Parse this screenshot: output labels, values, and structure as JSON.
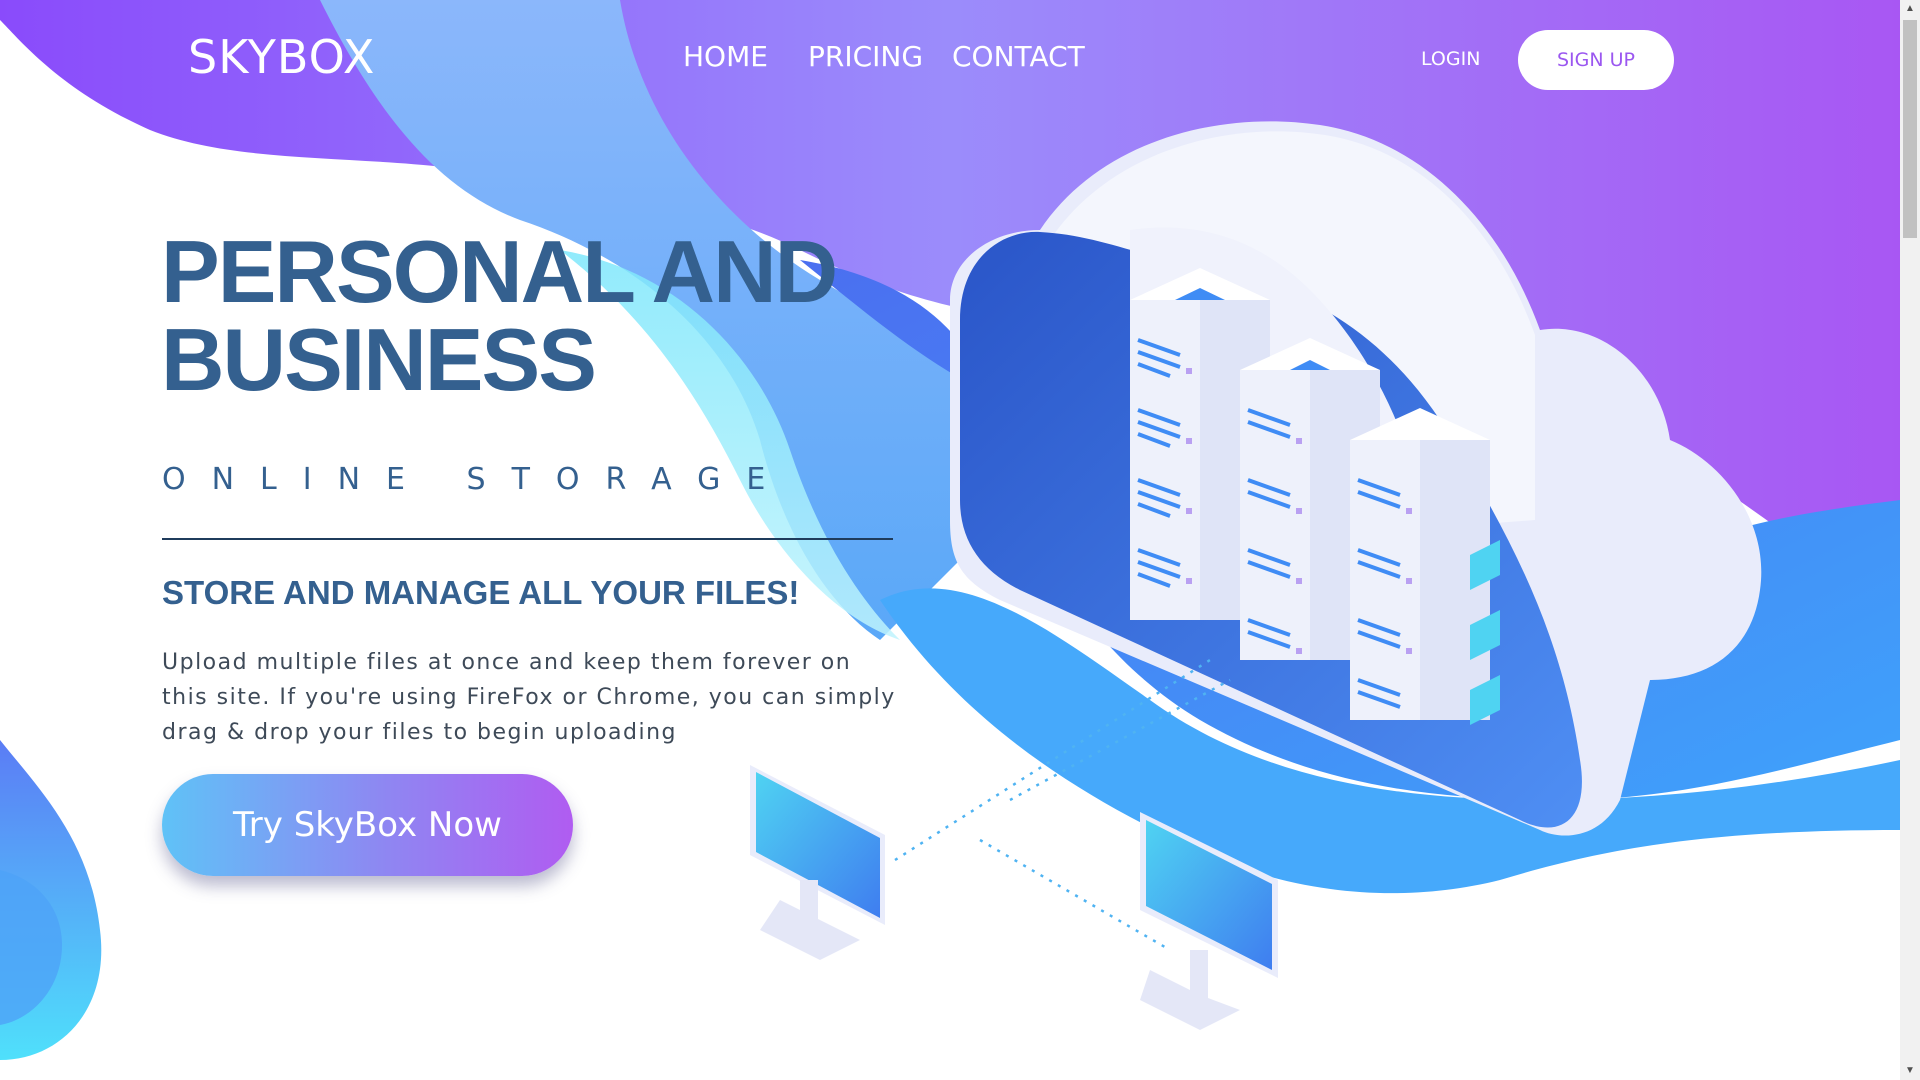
{
  "brand": {
    "logo": "SKYBOX"
  },
  "nav": {
    "links": [
      "HOME",
      "PRICING",
      "CONTACT"
    ],
    "login": "LOGIN",
    "signup": "SIGN UP"
  },
  "hero": {
    "title_line1": "PERSONAL AND",
    "title_line2": "BUSINESS",
    "subtitle": "ONLINE STORAGE",
    "tagline": "STORE AND MANAGE ALL YOUR FILES!",
    "description": "Upload multiple files at once and keep them forever on this site. If you're using FireFox or Chrome, you can simply drag & drop your files to begin uploading",
    "cta": "Try SkyBox Now"
  },
  "colors": {
    "heading": "#34608f",
    "purple": "#8c4bf5",
    "blue": "#3f8cf5",
    "cta_start": "#5fc2f7",
    "cta_end": "#b05cf1"
  },
  "icons": [
    "cloud-icon",
    "server-rack-icon",
    "monitor-icon"
  ]
}
